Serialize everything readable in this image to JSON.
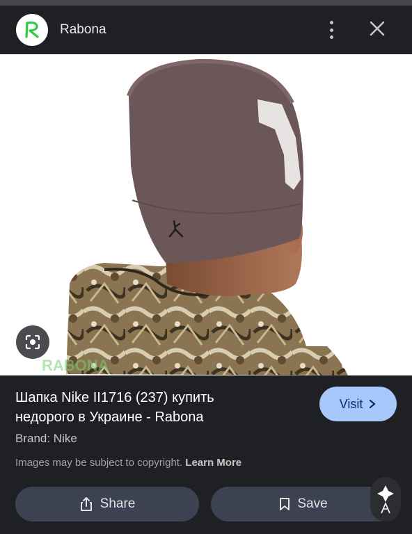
{
  "header": {
    "site_name": "Rabona",
    "logo_letter": "R"
  },
  "image": {
    "watermark": "RABONA"
  },
  "result": {
    "title_line1": "Шапка Nike II1716 (237) купить",
    "title_line2": "недорого в Украине - Rabona",
    "visit_label": "Visit",
    "brand": "Brand: Nike",
    "copyright_text": "Images may be subject to copyright.",
    "learn_more": "Learn More"
  },
  "actions": {
    "share_label": "Share",
    "save_label": "Save"
  },
  "icons": {
    "logo": "rabona-logo-icon",
    "menu": "more-vert-icon",
    "close": "close-icon",
    "lens": "lens-search-icon",
    "visit": "chevron-right-icon",
    "share": "share-icon",
    "save": "bookmark-icon",
    "fab": "assistant-icon"
  },
  "colors": {
    "background": "#1f2024",
    "visit_button": "#a8c7fa",
    "action_button": "#3c4251",
    "logo_green": "#2ecc40"
  }
}
